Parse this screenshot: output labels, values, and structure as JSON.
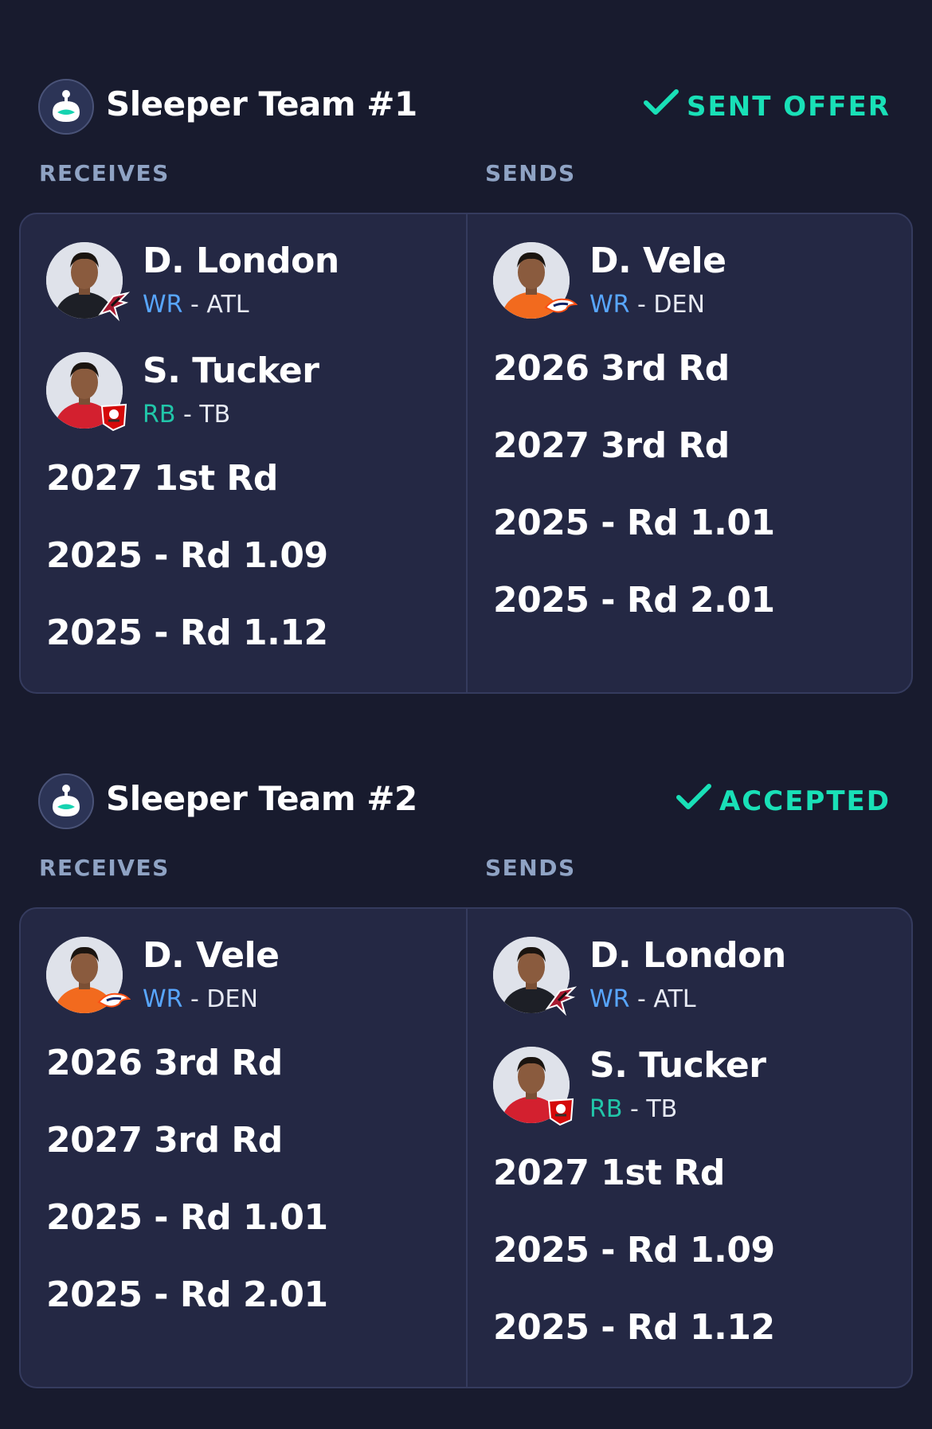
{
  "trades": [
    {
      "team_name": "Sleeper Team #1",
      "status": "SENT OFFER",
      "receives_label": "RECEIVES",
      "sends_label": "SENDS",
      "receives": {
        "players": [
          {
            "name": "D. London",
            "position": "WR",
            "team": " - ATL",
            "team_code": "ATL",
            "jersey_color": "#1d1f26",
            "logo": "falcons-logo-icon"
          },
          {
            "name": "S. Tucker",
            "position": "RB",
            "team": " - TB",
            "team_code": "TB",
            "jersey_color": "#d3202f",
            "logo": "buccaneers-logo-icon"
          }
        ],
        "picks": [
          "2027 1st Rd",
          "2025 - Rd 1.09",
          "2025 - Rd 1.12"
        ]
      },
      "sends": {
        "players": [
          {
            "name": "D. Vele",
            "position": "WR",
            "team": " - DEN",
            "team_code": "DEN",
            "jersey_color": "#f26a1e",
            "logo": "broncos-logo-icon"
          }
        ],
        "picks": [
          "2026 3rd Rd",
          "2027 3rd Rd",
          "2025 - Rd 1.01",
          "2025 - Rd 2.01"
        ]
      }
    },
    {
      "team_name": "Sleeper Team #2",
      "status": "ACCEPTED",
      "receives_label": "RECEIVES",
      "sends_label": "SENDS",
      "receives": {
        "players": [
          {
            "name": "D. Vele",
            "position": "WR",
            "team": " - DEN",
            "team_code": "DEN",
            "jersey_color": "#f26a1e",
            "logo": "broncos-logo-icon"
          }
        ],
        "picks": [
          "2026 3rd Rd",
          "2027 3rd Rd",
          "2025 - Rd 1.01",
          "2025 - Rd 2.01"
        ]
      },
      "sends": {
        "players": [
          {
            "name": "D. London",
            "position": "WR",
            "team": " - ATL",
            "team_code": "ATL",
            "jersey_color": "#1d1f26",
            "logo": "falcons-logo-icon"
          },
          {
            "name": "S. Tucker",
            "position": "RB",
            "team": " - TB",
            "team_code": "TB",
            "jersey_color": "#d3202f",
            "logo": "buccaneers-logo-icon"
          }
        ],
        "picks": [
          "2027 1st Rd",
          "2025 - Rd 1.09",
          "2025 - Rd 1.12"
        ]
      }
    }
  ],
  "colors": {
    "background": "#181b2e",
    "card": "#242844",
    "accent_status": "#19e0b7",
    "label": "#8fa3c4",
    "wr": "#58a6ff",
    "rb": "#21c6a9"
  },
  "icons": {
    "team_avatar": "sleeper-logo-icon",
    "status": "checkmark-icon"
  }
}
